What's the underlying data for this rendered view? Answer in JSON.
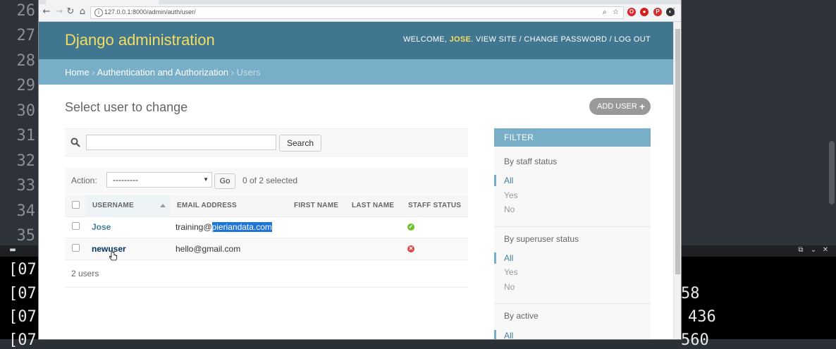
{
  "editor": {
    "line_numbers": [
      "26",
      "27",
      "28",
      "29",
      "30",
      "31",
      "32",
      "33",
      "34",
      "35"
    ]
  },
  "terminal": {
    "lines_left": [
      "[07",
      "[07",
      "[07",
      "[07"
    ],
    "lines_right": [
      "58",
      "436",
      "560"
    ]
  },
  "browser": {
    "url": "127.0.0.1:8000/admin/auth/user/"
  },
  "admin": {
    "site_title": "Django administration",
    "welcome_label": "WELCOME,",
    "username": "JOSE",
    "view_site": "VIEW SITE",
    "change_password": "CHANGE PASSWORD",
    "log_out": "LOG OUT",
    "separator": "/",
    "breadcrumbs": {
      "home": "Home",
      "app": "Authentication and Authorization",
      "current": "Users",
      "sep": "›"
    },
    "page_title": "Select user to change",
    "add_user": "ADD USER",
    "search_button": "Search",
    "action_label": "Action:",
    "action_select": "---------",
    "go_button": "Go",
    "selected_count": "0 of 2 selected",
    "columns": [
      "USERNAME",
      "EMAIL ADDRESS",
      "FIRST NAME",
      "LAST NAME",
      "STAFF STATUS"
    ],
    "rows": [
      {
        "username": "Jose",
        "email_prefix": "training@",
        "email_selected": "pieriandata.com",
        "first_name": "",
        "last_name": "",
        "staff": true
      },
      {
        "username": "newuser",
        "email_prefix": "hello@gmail.com",
        "email_selected": "",
        "first_name": "",
        "last_name": "",
        "staff": false
      }
    ],
    "result_count": "2 users",
    "filter": {
      "title": "FILTER",
      "groups": [
        {
          "title": "By staff status",
          "options": [
            "All",
            "Yes",
            "No"
          ],
          "selected": "All"
        },
        {
          "title": "By superuser status",
          "options": [
            "All",
            "Yes",
            "No"
          ],
          "selected": "All"
        },
        {
          "title": "By active",
          "options": [
            "All"
          ],
          "selected": "All"
        }
      ]
    },
    "colors": {
      "header": "#417690",
      "breadcrumbs": "#79aec8",
      "brand": "#f5dd5d",
      "link": "#447e9b",
      "staff_true": "#70bf2b",
      "staff_false": "#dd4646"
    }
  }
}
